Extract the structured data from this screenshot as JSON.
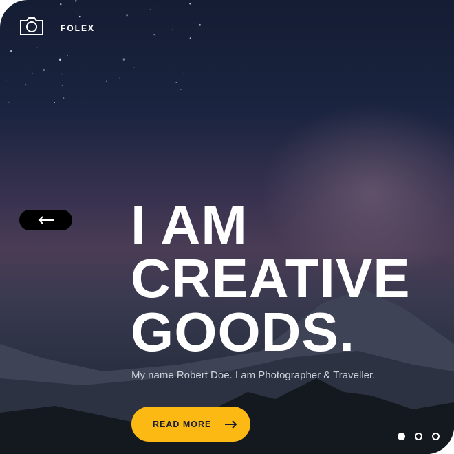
{
  "brand": {
    "name": "FOLEX",
    "icon": "camera-icon"
  },
  "hero": {
    "title_lines": [
      "I AM",
      "CREATIVE",
      "GOODS."
    ],
    "subtitle": "My name Robert Doe. I am Photographer & Traveller.",
    "cta_label": "READ MORE"
  },
  "nav": {
    "back_icon": "arrow-left-icon"
  },
  "slider": {
    "count": 3,
    "active": 1
  },
  "colors": {
    "accent": "#fdb913",
    "background": "#1b2440"
  }
}
